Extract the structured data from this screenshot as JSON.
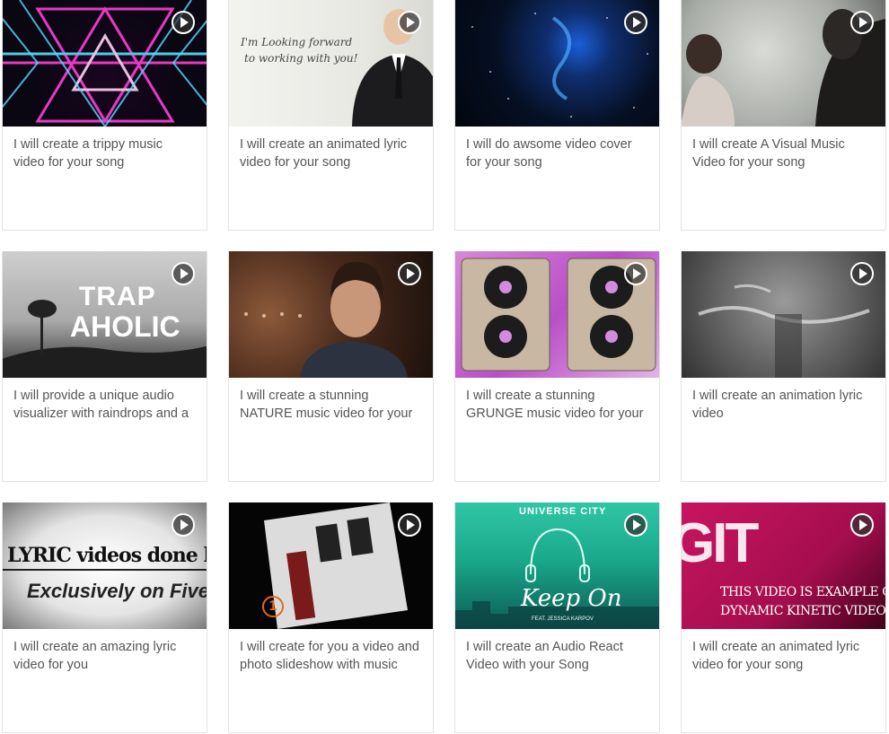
{
  "gigs": [
    {
      "title": "I will create a trippy music video for your song"
    },
    {
      "title": "I will create an animated lyric video for your song",
      "thumb_text": [
        "I'm Looking forward",
        "to working with you!"
      ]
    },
    {
      "title": "I will do awsome video cover for your song"
    },
    {
      "title": "I will create A Visual Music Video for your song"
    },
    {
      "title": "I will provide a unique audio visualizer with raindrops and a",
      "thumb_text": [
        "TRAP",
        "AHOLIC"
      ]
    },
    {
      "title": "I will create a stunning NATURE music video for your"
    },
    {
      "title": "I will create a stunning GRUNGE music video for your"
    },
    {
      "title": "I will create an animation lyric video"
    },
    {
      "title": "I will create an amazing lyric video for you",
      "thumb_text": [
        "LYRIC videos done here",
        "Exclusively on Fiverr"
      ]
    },
    {
      "title": "I will create for you a video and photo slideshow with music",
      "thumb_text": [
        "1"
      ]
    },
    {
      "title": "I will create an Audio React Video with your Song",
      "thumb_text": [
        "UNIVERSE CITY",
        "Keep On",
        "FEAT. JESSICA KARPOV"
      ]
    },
    {
      "title": "I will create an animated lyric video for your song",
      "thumb_text": [
        "GIT",
        "THIS VIDEO IS EXAMPLE OF",
        "DYNAMIC KINETIC VIDEO"
      ]
    }
  ],
  "icons": {
    "play": "play-icon"
  }
}
